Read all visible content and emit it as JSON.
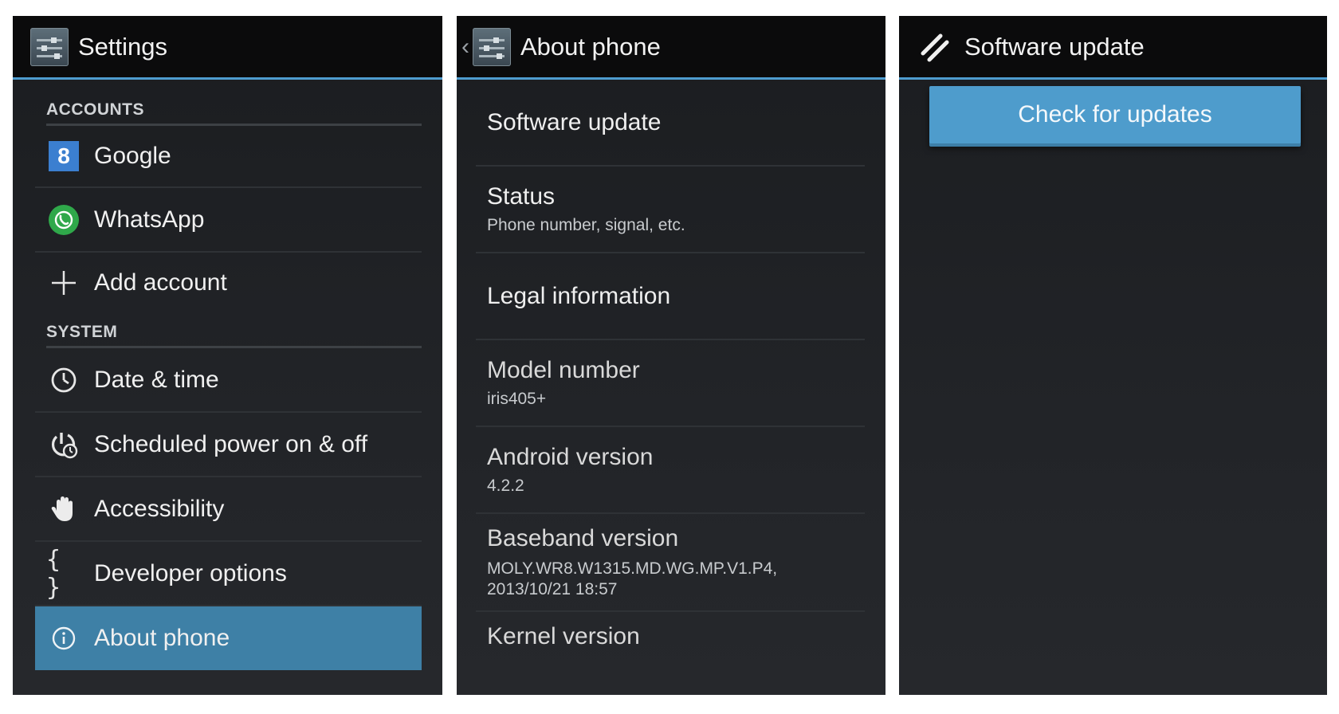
{
  "settings": {
    "title": "Settings",
    "sections": [
      {
        "header": "ACCOUNTS",
        "items": [
          {
            "label": "Google",
            "icon": "google-icon"
          },
          {
            "label": "WhatsApp",
            "icon": "whatsapp-icon"
          },
          {
            "label": "Add account",
            "icon": "plus-icon"
          }
        ]
      },
      {
        "header": "SYSTEM",
        "items": [
          {
            "label": "Date & time",
            "icon": "clock-icon"
          },
          {
            "label": "Scheduled power on & off",
            "icon": "power-clock-icon"
          },
          {
            "label": "Accessibility",
            "icon": "hand-icon"
          },
          {
            "label": "Developer options",
            "icon": "braces-icon",
            "glyph": "{ }"
          },
          {
            "label": "About phone",
            "icon": "info-icon",
            "selected": true
          }
        ]
      }
    ]
  },
  "about": {
    "title": "About phone",
    "items": [
      {
        "title": "Software update"
      },
      {
        "title": "Status",
        "subtitle": "Phone number, signal, etc."
      },
      {
        "title": "Legal information"
      },
      {
        "title": "Model number",
        "subtitle": "iris405+"
      },
      {
        "title": "Android version",
        "subtitle": "4.2.2"
      },
      {
        "title": "Baseband version",
        "subtitle": "MOLY.WR8.W1315.MD.WG.MP.V1.P4,",
        "subtitle2": "2013/10/21 18:57"
      },
      {
        "title": "Kernel version"
      }
    ]
  },
  "update": {
    "title": "Software update",
    "button_label": "Check for updates"
  },
  "colors": {
    "accent": "#4e9ccf",
    "selected_row": "#3e80a6",
    "action_bar": "#0b0b0c",
    "background": "#1f2124"
  }
}
